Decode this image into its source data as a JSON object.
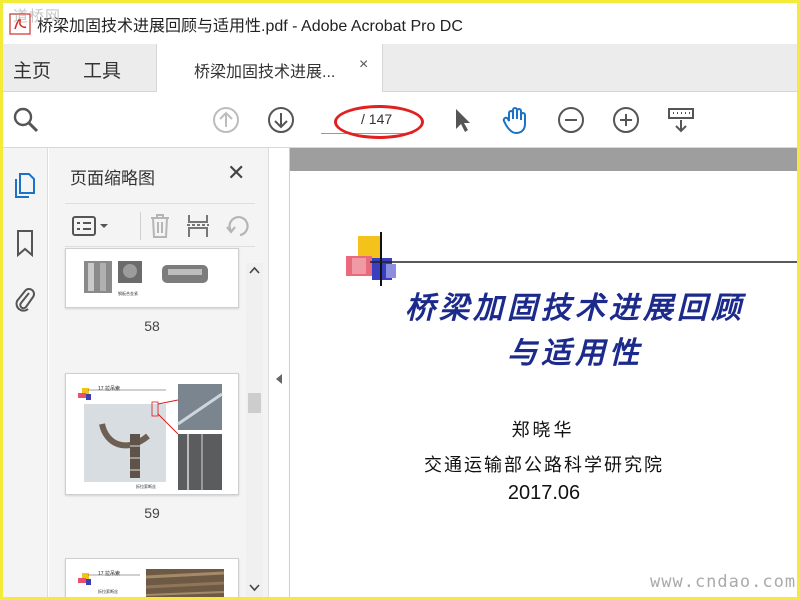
{
  "window": {
    "title": "桥梁加固技术进展回顾与适用性.pdf - Adobe Acrobat Pro DC",
    "watermark": "道桥网"
  },
  "menu": {
    "home": "主页",
    "tools": "工具"
  },
  "tab": {
    "label": "桥梁加固技术进展...",
    "close": "×"
  },
  "toolbar": {
    "page_count": "/ 147"
  },
  "sidebar": {
    "title": "页面缩略图",
    "close": "✕",
    "thumbnails": [
      {
        "number": "58",
        "caption": "钢板合金紧"
      },
      {
        "number": "59",
        "heading": "17 拉吊索",
        "caption": "拆拉索断丝"
      },
      {
        "number": "",
        "heading": "17 拉吊索",
        "caption": "拆拉索断丝"
      }
    ]
  },
  "document": {
    "title_line1": "桥梁加固技术进展回顾",
    "title_line2": "与适用性",
    "author": "郑晓华",
    "institute": "交通运输部公路科学研究院",
    "date": "2017.06"
  },
  "site_watermark": "www.cndao.com",
  "colors": {
    "outer_border": "#f2ec39",
    "accent_blue": "#1a73c8",
    "title_navy": "#1c2a8c",
    "highlight_red": "#e0211f"
  }
}
